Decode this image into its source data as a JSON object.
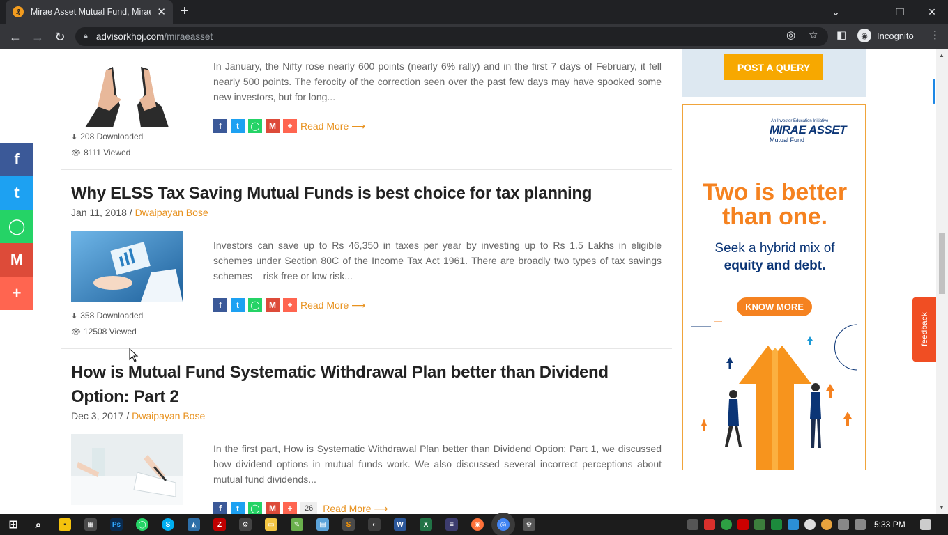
{
  "browser": {
    "tab_title": "Mirae Asset Mutual Fund, Mirae A",
    "tab_close": "✕",
    "new_tab": "+",
    "url_domain": "advisorkhoj.com",
    "url_path": "/miraeasset",
    "incognito_label": "Incognito"
  },
  "sidebar": {
    "post_query_label": "POST A QUERY",
    "ad": {
      "initiative": "An Investor Education Initiative",
      "brand": "MIRAE ASSET",
      "brand_sub": "Mutual Fund",
      "headline_line1": "Two is better",
      "headline_line2": "than one.",
      "sub_line1": "Seek a hybrid mix of",
      "sub_line2": "equity and debt.",
      "cta": "KNOW MORE"
    }
  },
  "posts": [
    {
      "excerpt": "In January, the Nifty rose nearly 600 points (nearly 6% rally) and in the first 7 days of February, it fell nearly 500 points. The ferocity of the correction seen over the past few days may have spooked some new investors, but for long...",
      "downloads": "208 Downloaded",
      "views": "8111 Viewed",
      "read_more": "Read More ⟶"
    },
    {
      "title": "Why ELSS Tax Saving Mutual Funds is best choice for tax planning",
      "date": "Jan 11, 2018",
      "separator": " / ",
      "author": "Dwaipayan Bose",
      "excerpt": "Investors can save up to Rs 46,350 in taxes per year by investing up to Rs 1.5 Lakhs in eligible schemes under Section 80C of the Income Tax Act 1961. There are broadly two types of tax savings schemes – risk free or low risk...",
      "downloads": "358 Downloaded",
      "views": "12508 Viewed",
      "read_more": "Read More ⟶"
    },
    {
      "title": "How is Mutual Fund Systematic Withdrawal Plan better than Dividend Option: Part 2",
      "date": "Dec 3, 2017",
      "separator": " / ",
      "author": "Dwaipayan Bose",
      "excerpt": "In the first part, How is Systematic Withdrawal Plan better than Dividend Option: Part 1, we discussed how dividend options in mutual funds work. We also discussed several incorrect perceptions about mutual fund dividends...",
      "share_count": "26",
      "read_more": "Read More ⟶"
    }
  ],
  "feedback_label": "feedback",
  "taskbar": {
    "time": "5:33 PM"
  },
  "colors": {
    "accent": "#e8921f",
    "facebook": "#3b5998",
    "twitter": "#1da1f2",
    "whatsapp": "#25d366",
    "gmail": "#dd4b39",
    "more": "#ff6550",
    "ad_orange": "#f58220",
    "ad_navy": "#0b3576"
  }
}
